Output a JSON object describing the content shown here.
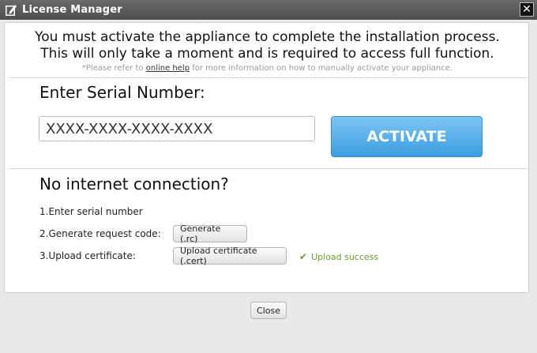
{
  "window": {
    "title": "License Manager",
    "close_symbol": "✕"
  },
  "message": {
    "line1": "You must activate the appliance to complete the installation process.",
    "line2": "This will only take a moment and is required to access full function."
  },
  "note": {
    "prefix": "*Please refer to ",
    "link": "online help",
    "suffix": " for more information on how to manually activate your appliance."
  },
  "serial": {
    "label": "Enter Serial Number:",
    "placeholder": "XXXX-XXXX-XXXX-XXXX",
    "value": ""
  },
  "activate_label": "ACTIVATE",
  "offline": {
    "heading": "No internet connection?",
    "step1": "1.Enter serial number",
    "step2": "2.Generate request code:",
    "step3": "3.Upload certificate:",
    "generate_label": "Generate (.rc)",
    "upload_label": "Upload certificate (.cert)",
    "upload_status": "Upload success",
    "status_color": "#6a9a2a"
  },
  "close_label": "Close",
  "colors": {
    "accent": "#3b9ee1",
    "titlebar": "#565656"
  }
}
